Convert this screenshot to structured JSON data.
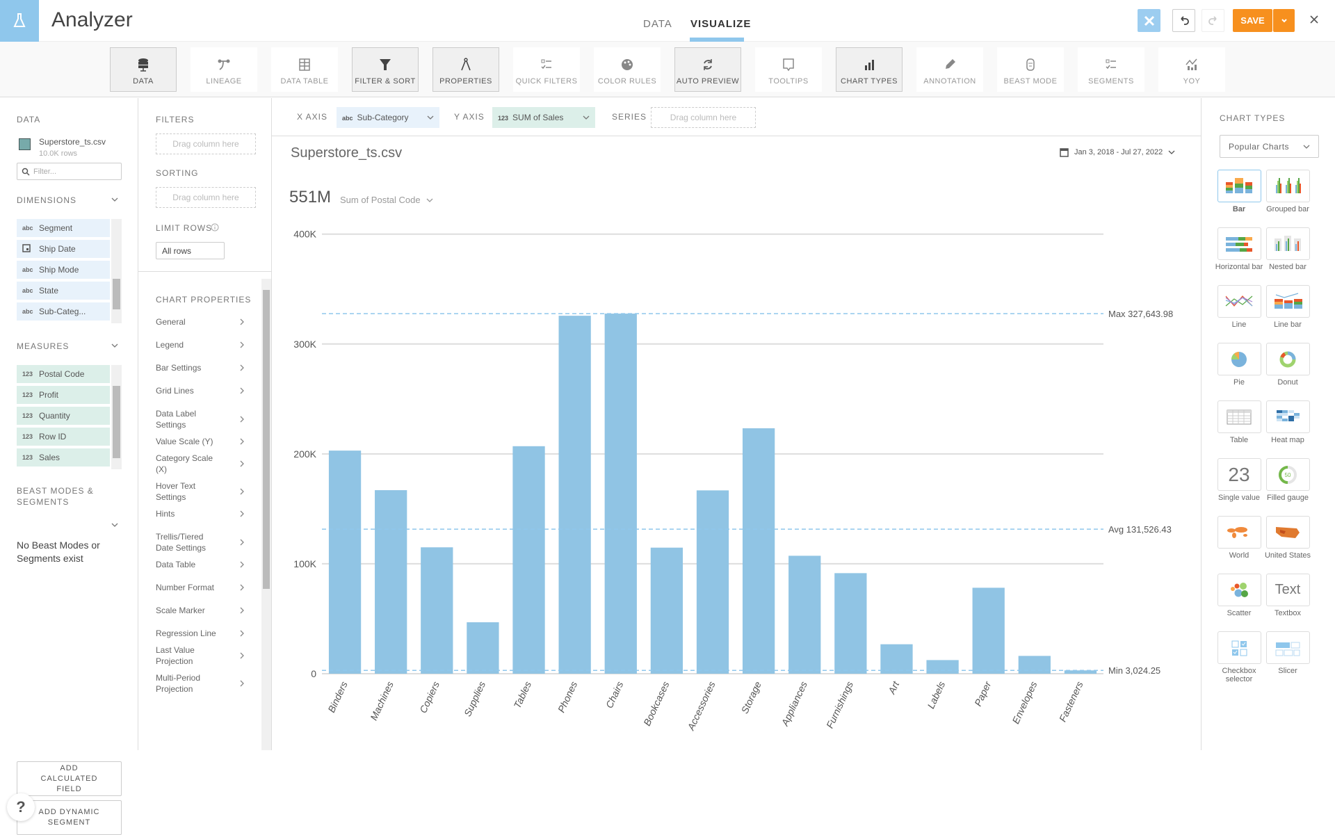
{
  "header": {
    "title": "Analyzer",
    "tabs": [
      {
        "label": "DATA",
        "active": false
      },
      {
        "label": "VISUALIZE",
        "active": true
      }
    ],
    "save_label": "SAVE",
    "accent": "#8fc7ec",
    "save_color": "#f7901e"
  },
  "toolbar": [
    {
      "label": "DATA",
      "icon": "database-icon",
      "selected": true
    },
    {
      "label": "LINEAGE",
      "icon": "lineage-icon",
      "selected": false
    },
    {
      "label": "DATA TABLE",
      "icon": "table-icon",
      "selected": false
    },
    {
      "label": "FILTER & SORT",
      "icon": "funnel-icon",
      "selected": true
    },
    {
      "label": "PROPERTIES",
      "icon": "compass-icon",
      "selected": true
    },
    {
      "label": "QUICK FILTERS",
      "icon": "checklist-icon",
      "selected": false
    },
    {
      "label": "COLOR RULES",
      "icon": "palette-icon",
      "selected": false
    },
    {
      "label": "AUTO PREVIEW",
      "icon": "refresh-icon",
      "selected": true
    },
    {
      "label": "TOOLTIPS",
      "icon": "tooltip-icon",
      "selected": false
    },
    {
      "label": "CHART TYPES",
      "icon": "bar-chart-icon",
      "selected": true
    },
    {
      "label": "ANNOTATION",
      "icon": "pen-icon",
      "selected": false
    },
    {
      "label": "BEAST MODE",
      "icon": "beast-icon",
      "selected": false
    },
    {
      "label": "SEGMENTS",
      "icon": "checklist-icon",
      "selected": false
    },
    {
      "label": "YOY",
      "icon": "yoy-icon",
      "selected": false
    }
  ],
  "left": {
    "data_label": "DATA",
    "dataset": "Superstore_ts.csv",
    "rows": "10.0K rows",
    "filter_placeholder": "Filter...",
    "dimensions_label": "DIMENSIONS",
    "dimensions": [
      {
        "type": "abc",
        "name": "Segment"
      },
      {
        "type": "date",
        "name": "Ship Date"
      },
      {
        "type": "abc",
        "name": "Ship Mode"
      },
      {
        "type": "abc",
        "name": "State"
      },
      {
        "type": "abc",
        "name": "Sub-Categ..."
      }
    ],
    "measures_label": "MEASURES",
    "measures": [
      {
        "type": "123",
        "name": "Postal Code"
      },
      {
        "type": "123",
        "name": "Profit"
      },
      {
        "type": "123",
        "name": "Quantity"
      },
      {
        "type": "123",
        "name": "Row ID"
      },
      {
        "type": "123",
        "name": "Sales"
      }
    ],
    "beast_label": "BEAST MODES & SEGMENTS",
    "beast_empty": "No Beast Modes or Segments exist",
    "add_calc": "ADD CALCULATED FIELD",
    "add_segment": "ADD DYNAMIC SEGMENT",
    "help": "?"
  },
  "mid": {
    "filters_label": "FILTERS",
    "sorting_label": "SORTING",
    "drag": "Drag column here",
    "limit_label": "LIMIT ROWS",
    "limit_value": "All rows",
    "props_label": "CHART PROPERTIES",
    "props": [
      "General",
      "Legend",
      "Bar Settings",
      "Grid Lines",
      "Data Label Settings",
      "Value Scale (Y)",
      "Category Scale (X)",
      "Hover Text Settings",
      "Hints",
      "Trellis/Tiered Date Settings",
      "Data Table",
      "Number Format",
      "Scale Marker",
      "Regression Line",
      "Last Value Projection",
      "Multi-Period Projection"
    ]
  },
  "axes": {
    "x_label": "X AXIS",
    "x_type": "abc",
    "x_value": "Sub-Category",
    "y_label": "Y AXIS",
    "y_type": "123",
    "y_value": "SUM of Sales",
    "series_label": "SERIES",
    "series_placeholder": "Drag column here"
  },
  "card": {
    "title": "Superstore_ts.csv",
    "date_range": "Jan 3, 2018 - Jul 27, 2022",
    "summary_value": "551M",
    "summary_label": "Sum of Postal Code"
  },
  "chart_data": {
    "type": "bar",
    "categories": [
      "Binders",
      "Machines",
      "Copiers",
      "Supplies",
      "Tables",
      "Phones",
      "Chairs",
      "Bookcases",
      "Accessories",
      "Storage",
      "Appliances",
      "Furnishings",
      "Art",
      "Labels",
      "Paper",
      "Envelopes",
      "Fasteners"
    ],
    "values": [
      203000,
      167000,
      115000,
      46800,
      207000,
      325700,
      327643.98,
      114700,
      166800,
      223300,
      107300,
      91500,
      26800,
      12400,
      78200,
      16200,
      3024.25
    ],
    "ylim": [
      0,
      400000
    ],
    "yticks": [
      {
        "v": 0,
        "label": "0"
      },
      {
        "v": 100000,
        "label": "100K"
      },
      {
        "v": 200000,
        "label": "200K"
      },
      {
        "v": 300000,
        "label": "300K"
      },
      {
        "v": 400000,
        "label": "400K"
      }
    ],
    "reference_lines": [
      {
        "v": 327643.98,
        "label": "Max 327,643.98"
      },
      {
        "v": 131526.43,
        "label": "Avg 131,526.43"
      },
      {
        "v": 3024.25,
        "label": "Min 3,024.25"
      }
    ],
    "bar_color": "#90c4e4",
    "grid": true
  },
  "right": {
    "label": "CHART TYPES",
    "dropdown": "Popular Charts",
    "types": [
      {
        "label": "Bar",
        "selected": true
      },
      {
        "label": "Grouped bar"
      },
      {
        "label": "Horizontal bar"
      },
      {
        "label": "Nested bar"
      },
      {
        "label": "Line"
      },
      {
        "label": "Line bar"
      },
      {
        "label": "Pie"
      },
      {
        "label": "Donut"
      },
      {
        "label": "Table"
      },
      {
        "label": "Heat map"
      },
      {
        "label": "Single value",
        "glyph": "23"
      },
      {
        "label": "Filled gauge",
        "glyph": "50"
      },
      {
        "label": "World"
      },
      {
        "label": "United States"
      },
      {
        "label": "Scatter"
      },
      {
        "label": "Textbox",
        "glyph": "Text"
      },
      {
        "label": "Checkbox selector"
      },
      {
        "label": "Slicer"
      }
    ]
  }
}
